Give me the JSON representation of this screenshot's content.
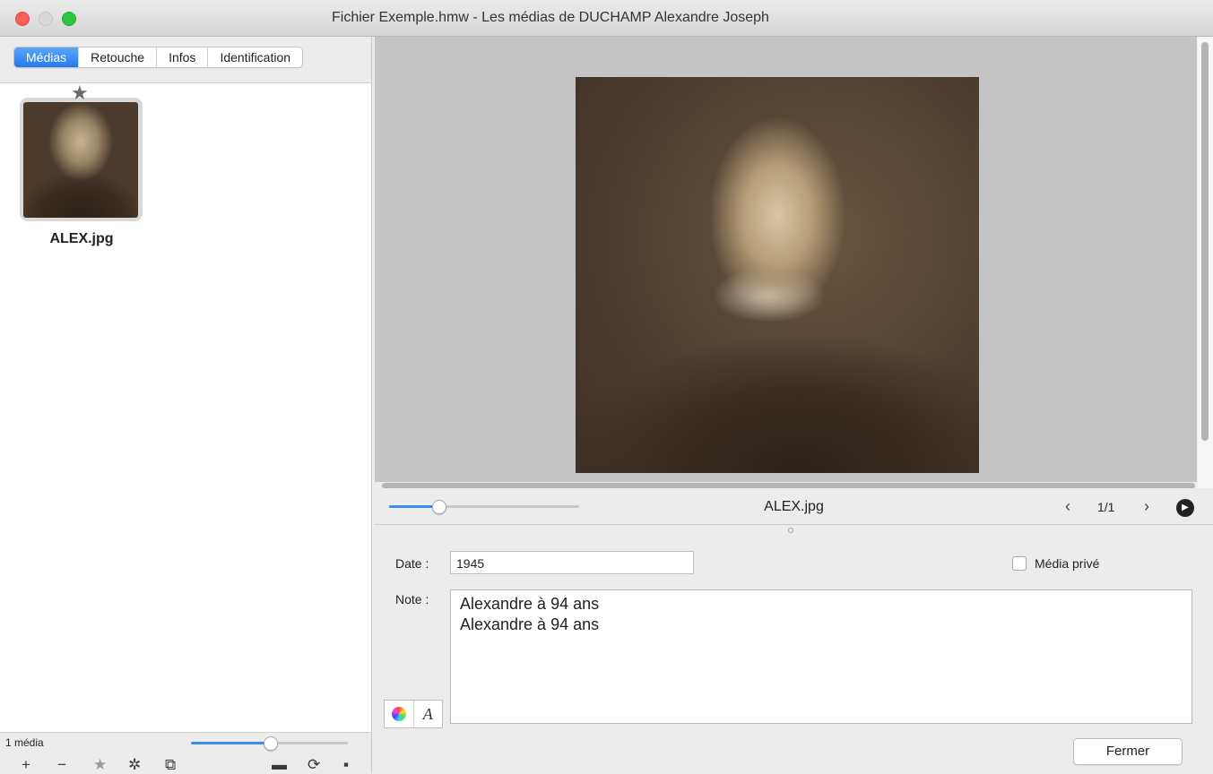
{
  "window": {
    "title": "Fichier Exemple.hmw - Les médias de DUCHAMP Alexandre Joseph"
  },
  "tabs": [
    {
      "label": "Médias",
      "active": true
    },
    {
      "label": "Retouche",
      "active": false
    },
    {
      "label": "Infos",
      "active": false
    },
    {
      "label": "Identification",
      "active": false
    }
  ],
  "thumbnails": [
    {
      "filename": "ALEX.jpg",
      "starred": true
    }
  ],
  "left_status": {
    "count": "1 média",
    "thumb_size_level": 0.5,
    "toolbar_icons": [
      "plus-icon",
      "minus-icon",
      "star-icon",
      "gear-icon",
      "duplicate-icon",
      "folder-icon",
      "refresh-icon",
      "save-icon"
    ]
  },
  "viewer": {
    "media_name": "ALEX.jpg",
    "page": "1/1",
    "zoom_level": 0.26,
    "prev_glyph": "‹",
    "next_glyph": "›",
    "play_glyph": "▶"
  },
  "form": {
    "date_label": "Date :",
    "date_value": "1945",
    "private_label": "Média privé",
    "private_checked": false,
    "note_label": "Note :",
    "note_lines": [
      "Alexandre à 94 ans",
      "Alexandre à 94 ans"
    ],
    "close_button": "Fermer"
  },
  "colors": {
    "accent": "#2478ee",
    "close_light": "#fc5f57",
    "max_light": "#2ac940"
  }
}
